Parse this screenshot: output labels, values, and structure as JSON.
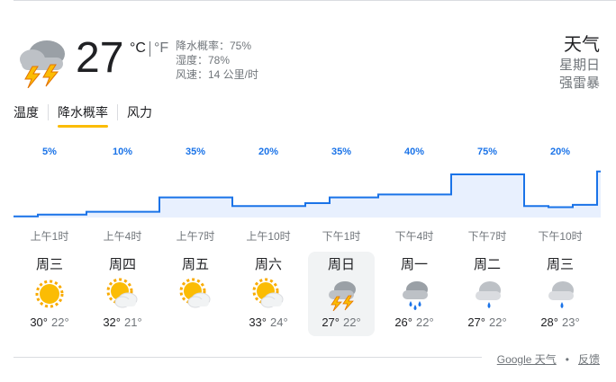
{
  "current": {
    "icon": "thunderstorm-icon",
    "temperature": "27",
    "unit_c": "°C",
    "unit_f": "°F",
    "details": [
      "降水概率：75%",
      "湿度：78%",
      "风速：14 公里/时"
    ]
  },
  "header": {
    "title": "天气",
    "day": "星期日",
    "condition": "强雷暴"
  },
  "tabs": [
    {
      "label": "温度"
    },
    {
      "label": "降水概率"
    },
    {
      "label": "风力"
    }
  ],
  "chart_data": {
    "type": "step",
    "title": "",
    "xlabel": "",
    "ylabel": "",
    "ylim": [
      0,
      100
    ],
    "categories": [
      "上午1时",
      "上午4时",
      "上午7时",
      "上午10时",
      "下午1时",
      "下午4时",
      "下午7时",
      "下午10时"
    ],
    "labels": [
      "5%",
      "10%",
      "35%",
      "20%",
      "35%",
      "40%",
      "75%",
      "20%"
    ],
    "values": [
      5,
      10,
      35,
      20,
      35,
      40,
      75,
      20
    ],
    "hourly_values": [
      2,
      5,
      5,
      10,
      10,
      10,
      35,
      35,
      35,
      20,
      20,
      20,
      25,
      35,
      35,
      40,
      40,
      40,
      75,
      75,
      75,
      20,
      18,
      22,
      80
    ],
    "colors": {
      "line": "#1a73e8",
      "fill": "#e8f0fe",
      "label": "#1a73e8"
    }
  },
  "days": [
    {
      "name": "周三",
      "icon": "sunny-icon",
      "hi": "30°",
      "lo": "22°"
    },
    {
      "name": "周四",
      "icon": "partly-cloudy-icon",
      "hi": "32°",
      "lo": "21°"
    },
    {
      "name": "周五",
      "icon": "partly-cloudy-icon",
      "hi": "",
      "lo": ""
    },
    {
      "name": "周六",
      "icon": "partly-cloudy-icon",
      "hi": "33°",
      "lo": "24°"
    },
    {
      "name": "周日",
      "icon": "thunderstorm-icon",
      "hi": "27°",
      "lo": "22°",
      "selected": true
    },
    {
      "name": "周一",
      "icon": "heavy-rain-icon",
      "hi": "26°",
      "lo": "22°"
    },
    {
      "name": "周二",
      "icon": "rain-icon",
      "hi": "27°",
      "lo": "22°"
    },
    {
      "name": "周三",
      "icon": "rain-icon",
      "hi": "28°",
      "lo": "23°"
    }
  ],
  "footer": {
    "source": "Google 天气",
    "dot": "•",
    "feedback": "反馈"
  }
}
